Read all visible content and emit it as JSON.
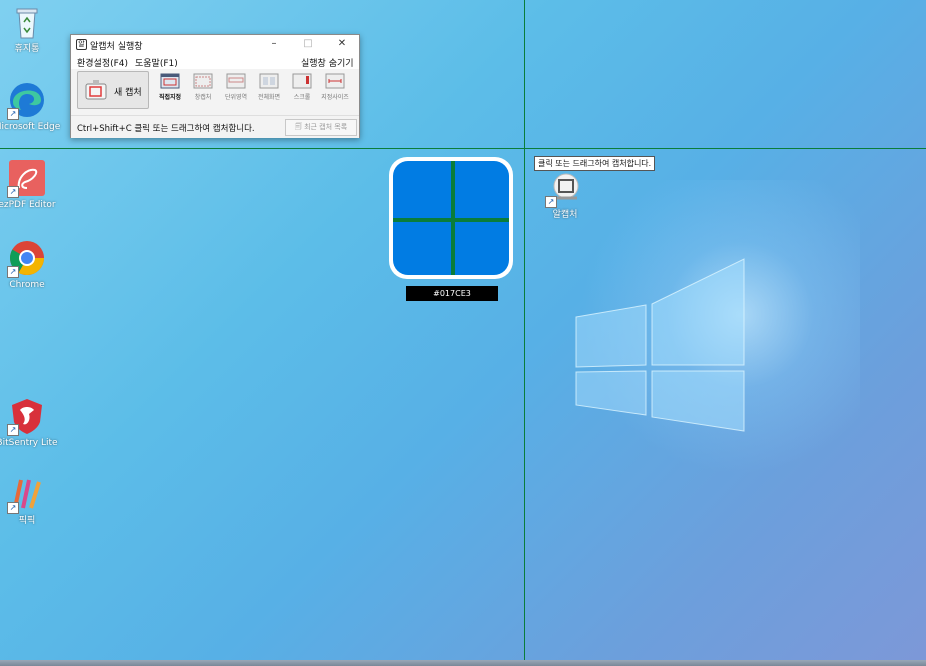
{
  "desktop": {
    "icons": [
      {
        "label": "휴지통",
        "icon": "recycle-bin-icon"
      },
      {
        "label": "Microsoft Edge",
        "icon": "edge-icon"
      },
      {
        "label": "ezPDF Editor",
        "icon": "ezpdf-icon"
      },
      {
        "label": "Chrome",
        "icon": "chrome-icon"
      },
      {
        "label": "BitSentry Lite",
        "icon": "bitsentry-icon"
      },
      {
        "label": "픽픽",
        "icon": "picpick-icon"
      },
      {
        "label": "알캡처",
        "icon": "alcapture-icon"
      }
    ]
  },
  "app_window": {
    "title": "알캡처 실행창",
    "controls": {
      "minimize": "–",
      "maximize": "□",
      "close": "✕"
    },
    "menu": {
      "settings": "환경설정(F4)",
      "help": "도움말(F1)",
      "hide": "실행창 숨기기"
    },
    "new_capture_label": "새 캡처",
    "tools": [
      {
        "label": "직접지정",
        "active": true
      },
      {
        "label": "창캡처",
        "active": false
      },
      {
        "label": "단위영역",
        "active": false
      },
      {
        "label": "전체화면",
        "active": false
      },
      {
        "label": "스크롤",
        "active": false
      },
      {
        "label": "지정사이즈",
        "active": false
      }
    ],
    "hint": "Ctrl+Shift+C 클릭 또는 드래그하여 캡처합니다.",
    "recent_label": "최근 캡처 목록"
  },
  "magnifier": {
    "color_code": "#017CE3"
  },
  "tooltip": "클릭 또는 드래그하여 캡처합니다.",
  "colors": {
    "picked": "#017CE3",
    "crosshair": "#0A7D3A"
  }
}
